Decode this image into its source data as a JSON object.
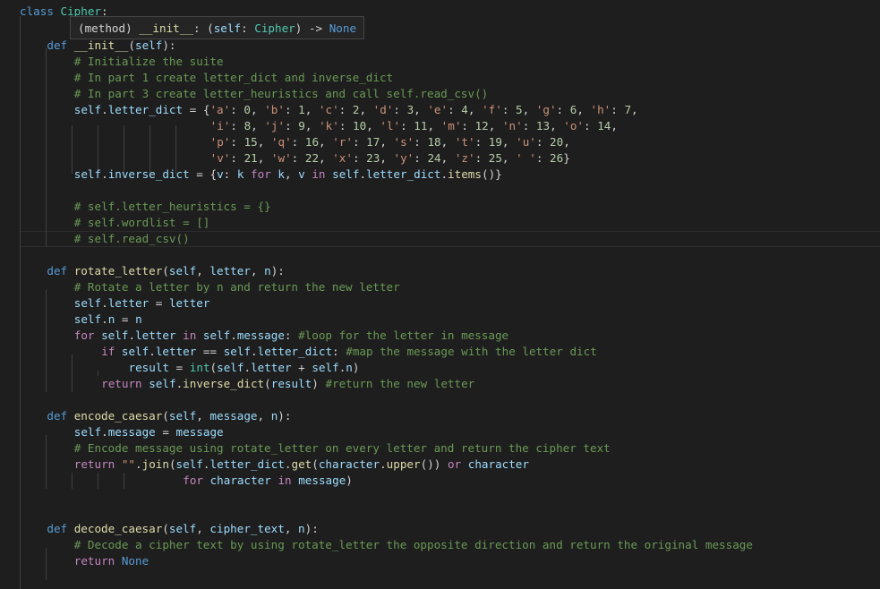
{
  "hover": {
    "text": "(method) __init__: (self: Cipher) -> None"
  },
  "lines": [
    "class Cipher:",
    "    def __init__(self):",
    "        # Initialize the suite",
    "        # In part 1 create letter_dict and inverse_dict",
    "        # In part 3 create letter_heuristics and call self.read_csv()",
    "        self.letter_dict = {'a': 0, 'b': 1, 'c': 2, 'd': 3, 'e': 4, 'f': 5, 'g': 6, 'h': 7,",
    "                            'i': 8, 'j': 9, 'k': 10, 'l': 11, 'm': 12, 'n': 13, 'o': 14,",
    "                            'p': 15, 'q': 16, 'r': 17, 's': 18, 't': 19, 'u': 20,",
    "                            'v': 21, 'w': 22, 'x': 23, 'y': 24, 'z': 25, ' ': 26}",
    "        self.inverse_dict = {v: k for k, v in self.letter_dict.items()}",
    "",
    "        # self.letter_heuristics = {}",
    "        # self.wordlist = []",
    "        # self.read_csv()",
    "",
    "    def rotate_letter(self, letter, n):",
    "        # Rotate a letter by n and return the new letter",
    "        self.letter = letter",
    "        self.n = n",
    "        for self.letter in self.message: #loop for the letter in message",
    "            if self.letter == self.letter_dict: #map the message with the letter dict",
    "                result = int(self.letter + self.n)",
    "            return self.inverse_dict(result) #return the new letter",
    "",
    "    def encode_caesar(self, message, n):",
    "        self.message = message",
    "        # Encode message using rotate_letter on every letter and return the cipher text",
    "        return \"\".join(self.letter_dict.get(character.upper()) or character",
    "                        for character in message)",
    "",
    "",
    "    def decode_caesar(self, cipher_text, n):",
    "        # Decode a cipher text by using rotate_letter the opposite direction and return the original message",
    "        return None"
  ]
}
